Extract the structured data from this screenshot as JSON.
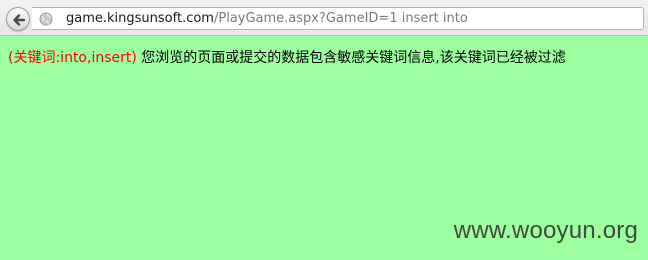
{
  "browser": {
    "url_prefix": "",
    "url_domain": "game.kingsunsoft.com",
    "url_rest": "/PlayGame.aspx?GameID=1 insert into",
    "back_icon": "back-arrow-icon",
    "site_icon": "globe-icon"
  },
  "page": {
    "keywords_label": "(关键词:into,insert)",
    "message": " 您浏览的页面或提交的数据包含敏感关键词信息,该关键词已经被过滤",
    "background_color": "#9eff9e",
    "keyword_color": "#ff0000"
  },
  "watermark": {
    "text": "www.wooyun.org"
  }
}
